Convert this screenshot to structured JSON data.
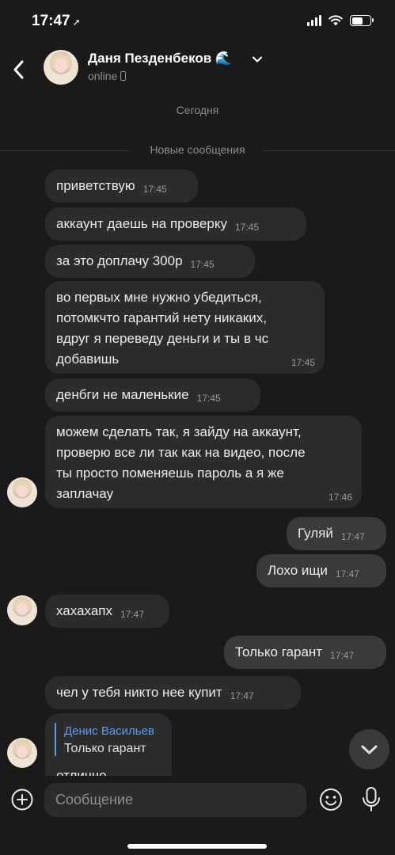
{
  "status_bar": {
    "time": "17:47",
    "location_arrow": "location-icon"
  },
  "header": {
    "contact_name": "Даня Пезденбеков 🌊",
    "status": "online",
    "icons": {
      "back": "chevron-left-icon",
      "expand": "chevron-down-icon",
      "device": "phone-icon"
    }
  },
  "chat": {
    "day_label": "Сегодня",
    "new_messages_label": "Новые сообщения",
    "messages": [
      {
        "side": "in",
        "text": "приветствую",
        "time": "17:45"
      },
      {
        "side": "in",
        "text": "аккаунт даешь на проверку",
        "time": "17:45"
      },
      {
        "side": "in",
        "text": "за это доплачу 300р",
        "time": "17:45"
      },
      {
        "side": "in",
        "text": "во первых мне нужно убедиться,\nпотомкчто гарантий нету никаких,\nвдруг я переведу деньги и ты в чс\nдобавишь",
        "time": "17:45"
      },
      {
        "side": "in",
        "text": "денбги не маленькие",
        "time": "17:45"
      },
      {
        "side": "in",
        "text": "можем сделать так, я зайду на аккаунт,\nпроверю все ли так как на видео, после\nты просто поменяешь пароль а я же\nзаплачау",
        "time": "17:46"
      },
      {
        "side": "out",
        "text": "Гуляй",
        "time": "17:47"
      },
      {
        "side": "out",
        "text": "Лохо ищи",
        "time": "17:47"
      },
      {
        "side": "in",
        "text": "хахахапх",
        "time": "17:47"
      },
      {
        "side": "out",
        "text": "Только гарант",
        "time": "17:47"
      },
      {
        "side": "in",
        "text": "чел у тебя никто нее купит",
        "time": "17:47"
      }
    ],
    "reply_message": {
      "reply_author": "Денис Васильев",
      "reply_quote": "Только гарант",
      "text": "отлично"
    }
  },
  "composer": {
    "placeholder": "Сообщение",
    "icons": {
      "attach": "plus-circle-icon",
      "emoji": "emoji-icon",
      "voice": "microphone-icon",
      "scroll": "chevron-down-icon"
    }
  }
}
